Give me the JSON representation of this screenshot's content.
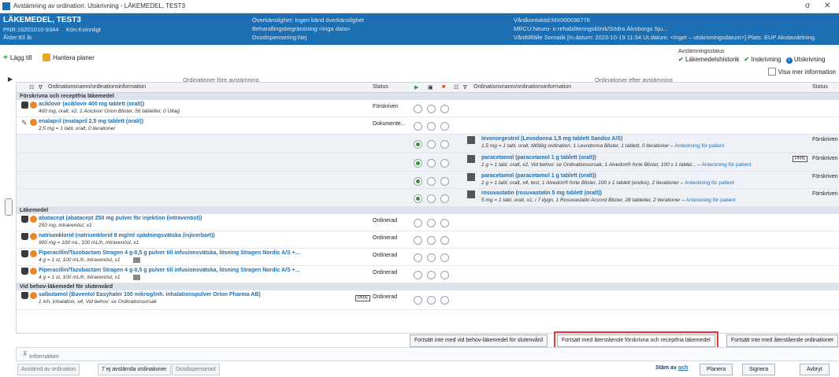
{
  "window": {
    "title": "Avstämning av ordination: Utskrivning - LÄKEMEDEL, TEST3",
    "min_glyph": "σ",
    "close_glyph": "✕"
  },
  "patient": {
    "name": "LÄKEMEDEL, TEST3",
    "pnr": "PNR:16201010-9344",
    "gender": "Kön:Kvinnligt",
    "age": "Ålder:83 år",
    "allergy": "Överkänslighet: Ingen känd överkänslighet",
    "restrictions": "Behandlingsbegränsning:<Inga data>",
    "dosdisp": "Dosdispensering:Nej",
    "contact": "Vårdkontaktid:MX000036776",
    "mrcu": "MRCU:Neuro- o rehabiliteringsklinik/Södra Älvsborgs Sju...",
    "episode": "Vårdtillfälle Somatik [In.datum: 2023-10-19 11:54 Ut.datum: <Inget – utskrivningsdatum>] Plats: EUP Akutavdelning"
  },
  "toolbar": {
    "add": "Lägg till",
    "plans": "Hantera planer"
  },
  "status": {
    "header": "Avstämningsstatus",
    "items": [
      "Läkemedelshistorik",
      "Inskrivning",
      "Utskrivning"
    ],
    "show_more": "Visa mer information"
  },
  "headers": {
    "before": "Ordinationer före avstämning",
    "after": "Ordinationer efter avstämning",
    "col_name": "Ordinationsnamn/ordinationsinformation",
    "col_status": "Status",
    "col_name_r": "Ordinationsnamn/ordinationsinformation",
    "col_status_r": "Status"
  },
  "groups": {
    "g1": "Förskrivna och receptfria läkemedel",
    "g2": "Läkemedel",
    "g3": "Vid behov-läkemedel för slutenvård"
  },
  "rows": {
    "r1": {
      "drug": "aciklovir (aciklovir 400 mg tablett (oralt))",
      "dose": "400 mg, oralt, x2, 1 Aciclovir Orion Blister, 56 tabletter, 0 Uttag",
      "status": "Förskriven"
    },
    "r2": {
      "drug": "enalapril (enalapril 2,5 mg tablett (oralt))",
      "dose": "2,5 mg = 1 tabl, oralt, 0 iterationer",
      "status": "Dokumente..."
    },
    "r5": {
      "drug": "abatacept (abatacept 250 mg pulver för injektion (intravenöst))",
      "dose": "250 mg, intravenöst, x1",
      "status": "Ordinerad"
    },
    "r6": {
      "drug": "natriumklorid (natriumklorid 9 mg/ml spädningsvätska (injicerbart))",
      "dose": "900 mg = 100 mL, 100 mL/h, intravenöst, x1",
      "status": "Ordinerad"
    },
    "r7": {
      "drug": "Piperacillin/Tazobactam Stragen 4 g-0,5 g pulver till infusionsvätska, lösning Stragen Nordic A/S +...",
      "dose": "4 g = 1 st, 100 mL/h, intravenöst, x1",
      "status": "Ordinerad"
    },
    "r8": {
      "drug": "Piperacillin/Tazobactam Stragen 4 g-0,5 g pulver till infusionsvätska, lösning Stragen Nordic A/S +...",
      "dose": "4 g = 1 st, 100 mL/h, intravenöst, x1",
      "status": "Ordinerad"
    },
    "r9": {
      "drug": "salbutamol (Buventol Easyhaler 100 mikrog/inh. inhalationspulver Orion Pharma AB)",
      "dose": "1 inh, inhalation, x4, Vid behov: se Ordinationsorsak",
      "status": "Ordinerad"
    }
  },
  "after": {
    "a1": {
      "drug": "levonorgestrel (Levodonna 1,5 mg tablett Sandoz A/S)",
      "dose": "1,5 mg = 1 tabl, oralt, tillfällig ordination, 1 Levodonna Blister, 1 tablett, 0 iterationer –",
      "link": "Anteckning för patient",
      "status": "Förskriven"
    },
    "a2": {
      "drug": "paracetamol (paracetamol 1 g tablett (oralt))",
      "dose": "1 g = 1 tabl, oralt, x2, Vid behov: se Ordinationsorsak, 1 Alvedon® forte Blister, 100 x 1 tablet... –",
      "link": "Anteckning för patient",
      "status": "Förskriven"
    },
    "a3": {
      "drug": "paracetamol (paracetamol 1 g tablett (oralt))",
      "dose": "1 g = 1 tabl, oralt, x4, test, 1 Alvedon® forte Blister, 100 x 1 tablett (endos), 2 iterationer –",
      "link": "Anteckning för patient",
      "status": "Förskriven"
    },
    "a4": {
      "drug": "rosuvastatin (rosuvastatin 5 mg tablett (oralt))",
      "dose": "5 mg = 1 tabl, oralt, x1, i 7 dygn, 1 Rosuvastatin Accord Blister, 28 tabletter, 2 iterationer –",
      "link": "Anteckning för patient",
      "status": "Förskriven"
    }
  },
  "prn": "PRN",
  "actions": {
    "b1": "Fortsätt inte med vid behov-läkemedel för slutenvård",
    "b2": "Fortsätt med återstående förskrivna och receptfria läkemedel",
    "b3": "Fortsätt inte med återstående ordinationer"
  },
  "info": "Information",
  "footer": {
    "f1": "Avstämd av ordination",
    "f2": "7 ej avstämda ordinationer",
    "f3": "Dosdispenserad",
    "stam": "Stäm av",
    "och": "och",
    "planera": "Planera",
    "signera": "Signera",
    "avbryt": "Avbryt"
  }
}
